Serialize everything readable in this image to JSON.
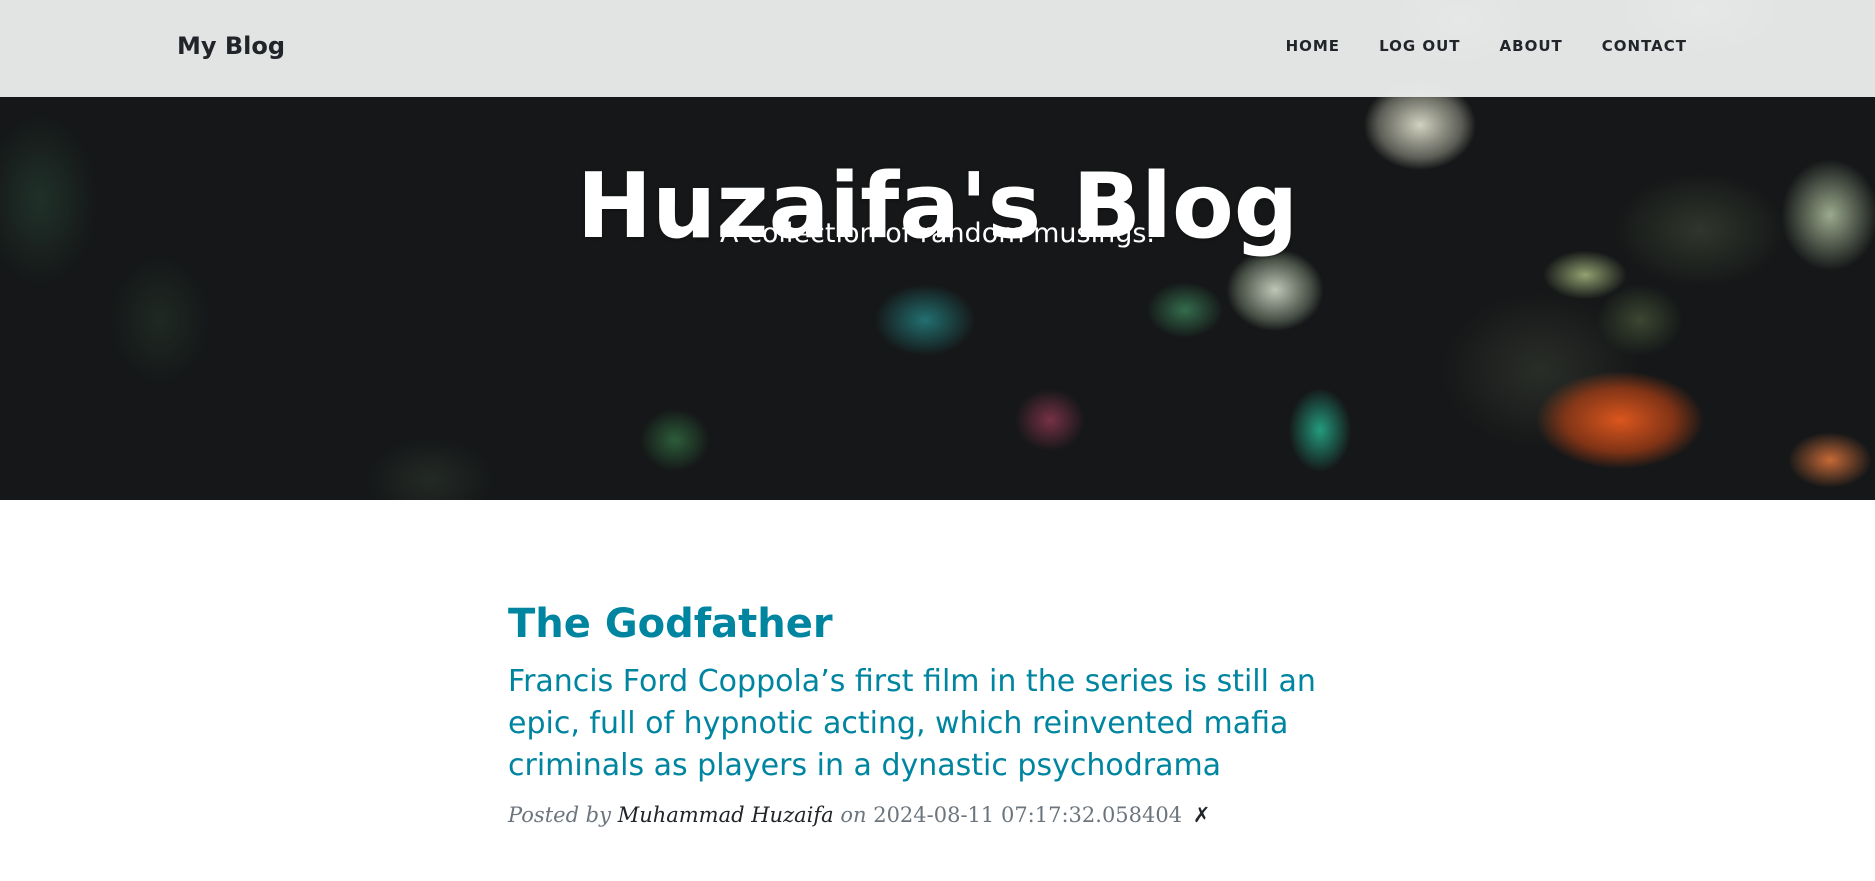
{
  "navbar": {
    "brand": "My Blog",
    "links": [
      {
        "label": "HOME"
      },
      {
        "label": "LOG OUT"
      },
      {
        "label": "ABOUT"
      },
      {
        "label": "CONTACT"
      }
    ]
  },
  "header": {
    "heading": "Huzaifa's Blog",
    "subheading": "A collection of random musings."
  },
  "posts": [
    {
      "title": "The Godfather",
      "subtitle": "Francis Ford Coppola’s first film in the series is still an epic, full of hypnotic acting, which reinvented mafia criminals as players in a dynastic psychodrama",
      "meta_prefix": "Posted by",
      "author": "Muhammad Huzaifa",
      "meta_on": "on",
      "date": "2024-08-11 07:17:32.058404",
      "delete_symbol": "✗"
    }
  ],
  "colors": {
    "accent": "#0085a1",
    "text_dark": "#212529",
    "meta_gray": "#6c757d",
    "navbar_bg": "#e9eaea"
  }
}
